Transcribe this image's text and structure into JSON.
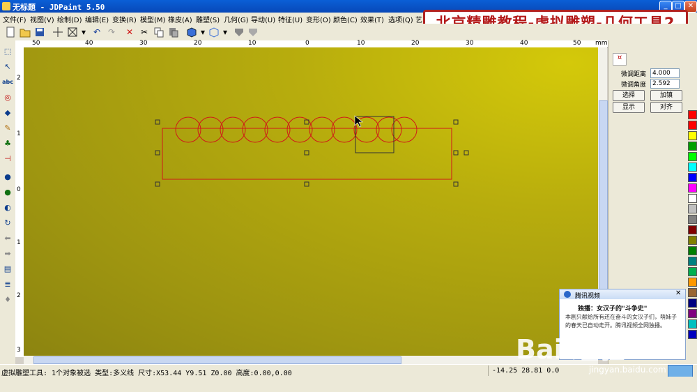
{
  "window": {
    "title": "无标题 - JDPaint 5.50",
    "min_glyph": "_",
    "max_glyph": "□",
    "close_glyph": "✕"
  },
  "banner": {
    "text": "北京精雕教程-虚拟雕塑-几何工具2"
  },
  "menu": [
    "文件(F)",
    "视图(V)",
    "绘制(D)",
    "编辑(E)",
    "变换(R)",
    "模型(M)",
    "橡皮(A)",
    "雕塑(S)",
    "几何(G)",
    "导动(U)",
    "特征(U)",
    "变形(O)",
    "颜色(C)",
    "效果(T)",
    "选项(Q)",
    "艺"
  ],
  "ruler": {
    "h_labels": [
      "50",
      "40",
      "30",
      "20",
      "10",
      "0",
      "10",
      "20",
      "30",
      "40",
      "50"
    ],
    "unit": "mm",
    "v_labels": [
      "2",
      "1",
      "0",
      "1",
      "2",
      "3"
    ]
  },
  "panel": {
    "tab_glyph": "¤",
    "distance_label": "微调距离",
    "distance_value": "4.000",
    "angle_label": "微调角度",
    "angle_value": "2.592",
    "btn_select": "选择",
    "btn_thicken": "加镇",
    "btn_show": "显示",
    "btn_align": "对齐"
  },
  "palette": [
    "#ff0000",
    "#ff0000",
    "#ffff00",
    "#00a000",
    "#00ff00",
    "#00ffff",
    "#0000ff",
    "#ff00ff",
    "#ffffff",
    "#c0c0c0",
    "#808080",
    "#800000",
    "#808000",
    "#008000",
    "#008080",
    "#00b050",
    "#ff9900",
    "#996633",
    "#000080",
    "#800080",
    "#00c0c0",
    "#0000c0"
  ],
  "popup": {
    "header": "腾讯视频",
    "subtitle": "独播：女汉子的\"斗争史\"",
    "body": "本剧只献给所有还在奋斗的女汉子们，萌妹子的春天已自动走开。腾讯视频全网独播。",
    "close_glyph": "✕"
  },
  "status": {
    "text": "虚拟雕塑工具: 1个对象被选 类型:多义线 尺寸:X53.44 Y9.51 Z0.00 高度:0.00,0.00",
    "coords": "-14.25 28.81 0.0"
  },
  "watermark": {
    "text": "Bai 经验",
    "url": "jingyan.baidu.com"
  },
  "icons": [
    "new-icon",
    "open-icon",
    "save-icon",
    "crosshair-icon",
    "select-box-icon",
    "undo-icon",
    "redo-icon",
    "delete-icon",
    "cut-icon",
    "copy-icon",
    "paste-icon",
    "cube-icon",
    "box-icon",
    "shield-icon"
  ]
}
